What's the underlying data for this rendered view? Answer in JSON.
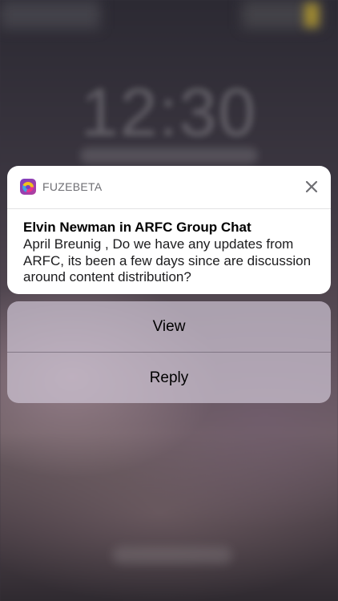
{
  "lock_screen": {
    "time": "12:30"
  },
  "notification": {
    "app_name": "FUZEBETA",
    "app_icon": "fuze-app-icon",
    "close_icon": "close-icon",
    "title": "Elvin Newman in ARFC Group Chat",
    "message": "April Breunig , Do we have any updates from ARFC, its been a few days since are discussion around content distribution?"
  },
  "actions": [
    {
      "label": "View"
    },
    {
      "label": "Reply"
    }
  ],
  "colors": {
    "card_background": "#ffffff",
    "app_name_text": "#6e6e73",
    "title_text": "#000000",
    "action_sheet_tint": "#cdc3d2"
  }
}
